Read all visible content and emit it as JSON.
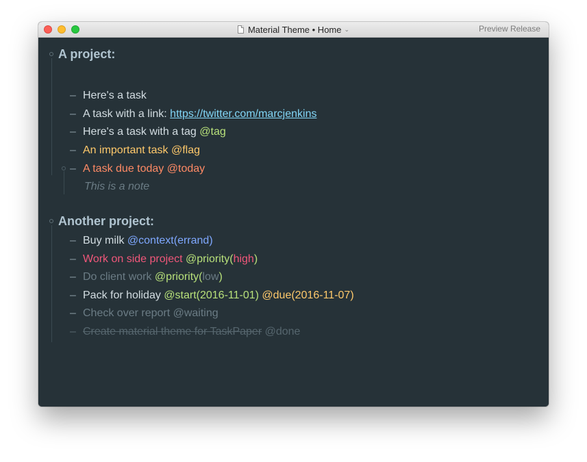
{
  "window": {
    "title": "Material Theme • Home",
    "badge": "Preview Release"
  },
  "colors": {
    "background": "#263238",
    "project_title": "#b0c4d0",
    "text": "#d3dde2",
    "link": "#82d6f7",
    "tag": "#b8e17a",
    "flag": "#ffc96b",
    "today": "#ff8a65",
    "context": "#7fa8ff",
    "priority_high": "#f0577a",
    "dim": "#6b7c85"
  },
  "projects": [
    {
      "title": "A project:",
      "items": [
        {
          "dash": "–",
          "text": "Here's a task"
        },
        {
          "dash": "–",
          "text": "A task with a link: ",
          "link": "https://twitter.com/marcjenkins"
        },
        {
          "dash": "–",
          "text": "Here's a task with a tag ",
          "tag": "@tag"
        },
        {
          "dash": "–",
          "text": "An important task @flag"
        },
        {
          "dash": "–",
          "text": "A task due today @today"
        },
        {
          "note": "This is a note"
        }
      ]
    },
    {
      "title": "Another project:",
      "items": [
        {
          "dash": "–",
          "text": "Buy milk ",
          "tag": "@context(errand)"
        },
        {
          "dash": "–",
          "text": "Work on side project ",
          "tag_prefix": "@priority(",
          "tag_value": "high",
          "tag_suffix": ")"
        },
        {
          "dash": "–",
          "text": "Do client work ",
          "tag_prefix": "@priority(",
          "tag_value": "low",
          "tag_suffix": ")"
        },
        {
          "dash": "–",
          "text": "Pack for holiday ",
          "tag": "@start(2016-11-01)",
          "tag2_prefix": " @due(",
          "tag2_value": "2016-11-07",
          "tag2_suffix": ")"
        },
        {
          "dash": "–",
          "text": "Check over report @waiting"
        },
        {
          "dash": "–",
          "text": "Create material theme for TaskPaper",
          "tag": " @done"
        }
      ]
    }
  ]
}
